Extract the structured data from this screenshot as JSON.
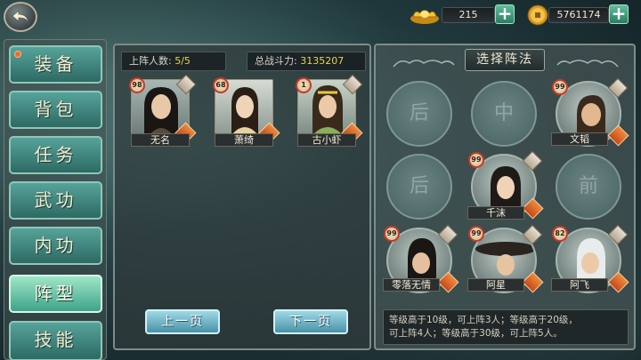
{
  "header": {
    "gold": "215",
    "coins": "5761174"
  },
  "sidebar": {
    "items": [
      {
        "label": "装备",
        "active": false
      },
      {
        "label": "背包",
        "active": false
      },
      {
        "label": "任务",
        "active": false
      },
      {
        "label": "武功",
        "active": false
      },
      {
        "label": "内功",
        "active": false
      },
      {
        "label": "阵型",
        "active": true
      },
      {
        "label": "技能",
        "active": false
      }
    ]
  },
  "lineup": {
    "count_label": "上阵人数:",
    "count_value": "5/5",
    "power_label": "总战斗力:",
    "power_value": "3135207",
    "heroes": [
      {
        "name": "无名",
        "level": "98"
      },
      {
        "name": "萧绮",
        "level": "68"
      },
      {
        "name": "古小虾",
        "level": "1"
      }
    ],
    "prev_label": "上一页",
    "next_label": "下一页"
  },
  "formation": {
    "title": "选择阵法",
    "empty_slots": [
      "后",
      "中",
      "后",
      "前"
    ],
    "placed": [
      {
        "name": "文韬",
        "level": "99"
      },
      {
        "name": "千沫",
        "level": "99"
      },
      {
        "name": "零落无情",
        "level": "99"
      },
      {
        "name": "阿星",
        "level": "99"
      },
      {
        "name": "阿飞",
        "level": "82"
      }
    ],
    "info_line1": "等级高于10级，可上阵3人；等级高于20级，",
    "info_line2": "可上阵4人；等级高于30级，可上阵5人。"
  },
  "colors": {
    "accent": "#3fa38a",
    "level_ring": "#c43a2a",
    "value_yellow": "#e8d25a"
  }
}
